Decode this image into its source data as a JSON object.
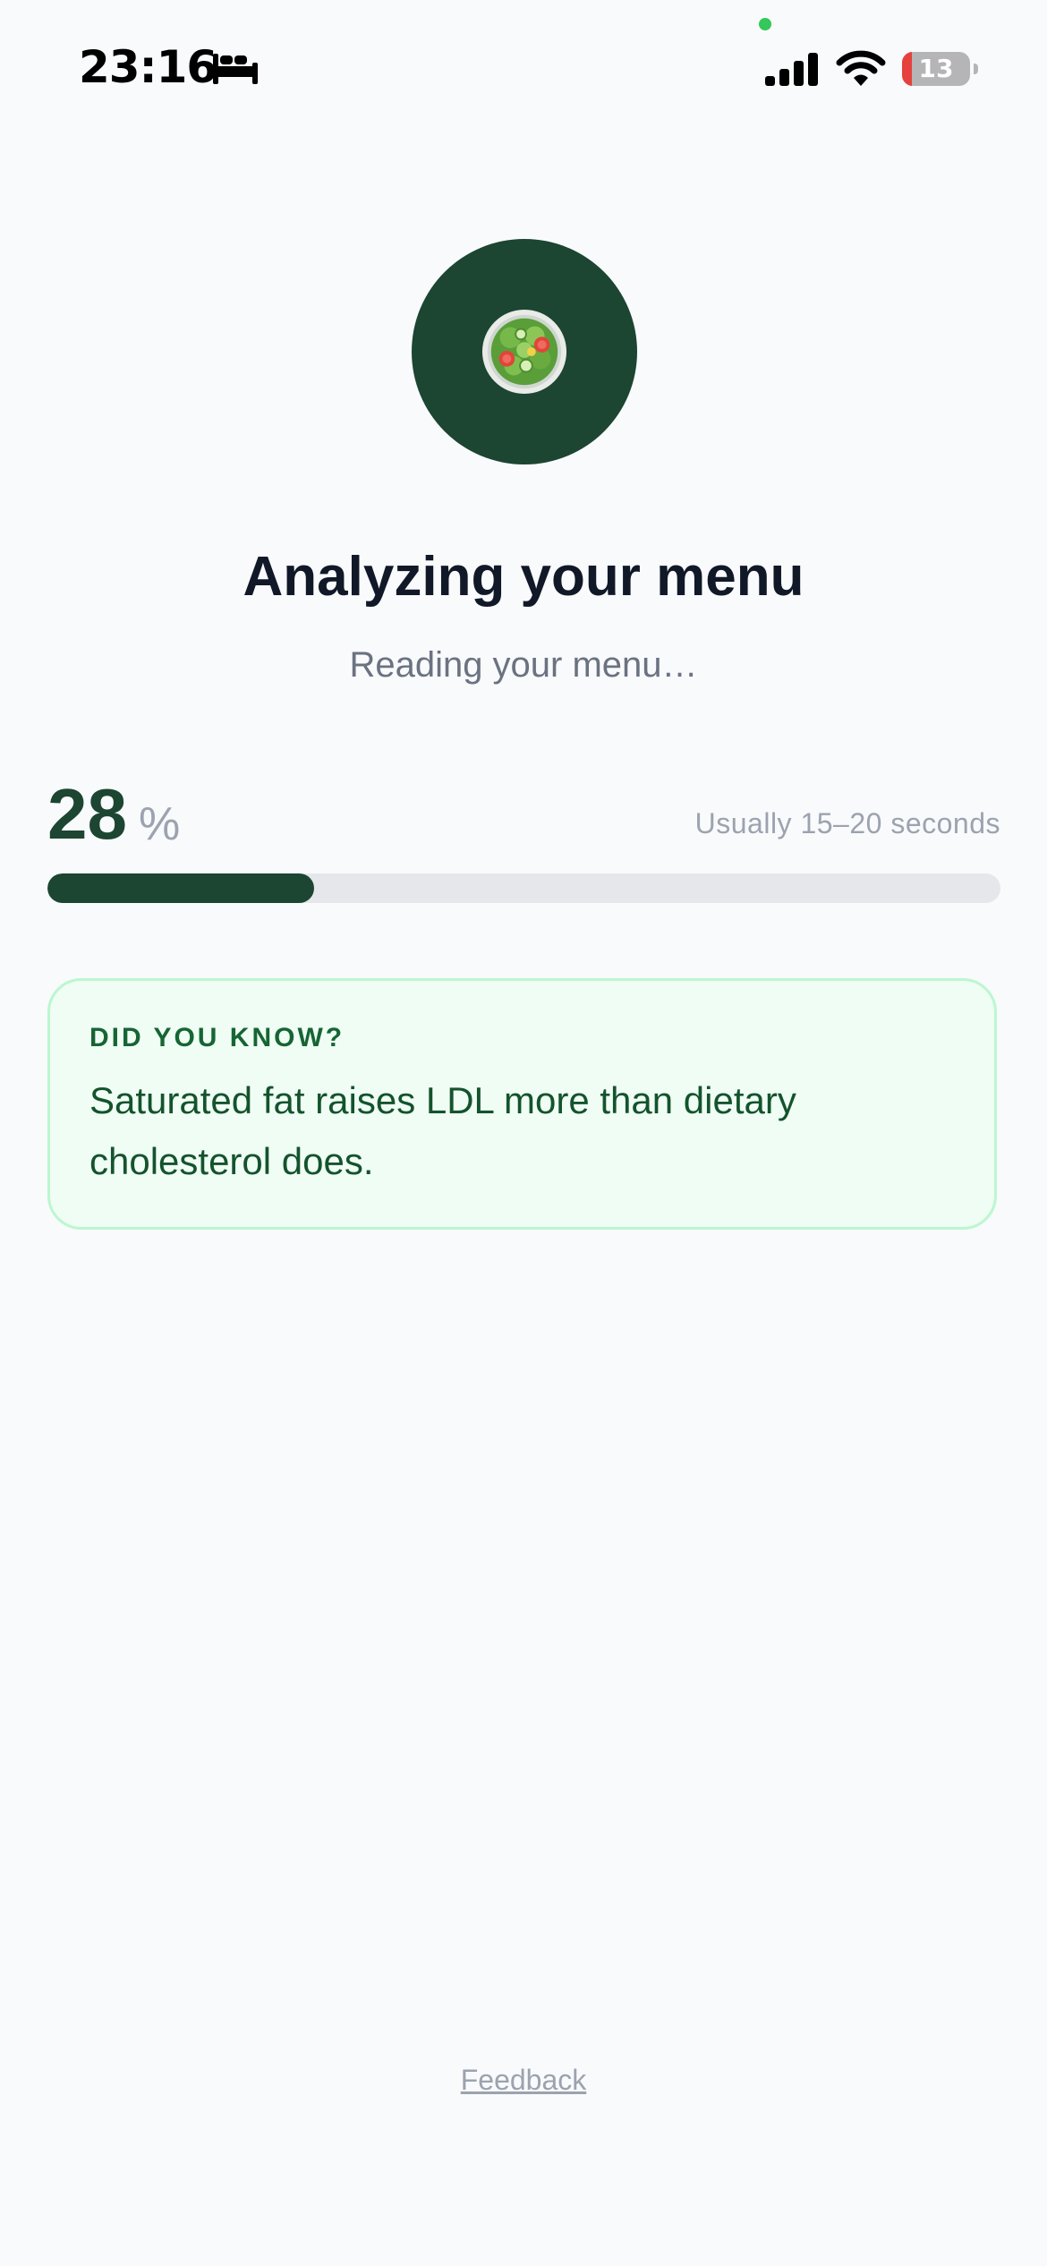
{
  "status_bar": {
    "time": "23:16",
    "focus_icon": "bed-icon",
    "signal_icon": "cellular-signal-icon",
    "wifi_icon": "wifi-icon",
    "battery_level": "13",
    "battery_color": "#e6413d",
    "mic_indicator_color": "#34c759"
  },
  "hero": {
    "icon": "green-salad-icon",
    "circle_color": "#1c4532"
  },
  "title": "Analyzing your menu",
  "subtitle": "Reading your menu…",
  "progress": {
    "value": "28",
    "unit": "%",
    "fraction": 0.28,
    "hint": "Usually 15–20 seconds"
  },
  "tip": {
    "heading": "DID YOU KNOW?",
    "text": "Saturated fat raises LDL more than dietary cholesterol does."
  },
  "footer": {
    "feedback_label": "Feedback"
  },
  "colors": {
    "accent": "#1c4532",
    "background": "#f8fafc",
    "tip_background": "#f0fdf4",
    "tip_border": "#bbf7d0"
  }
}
